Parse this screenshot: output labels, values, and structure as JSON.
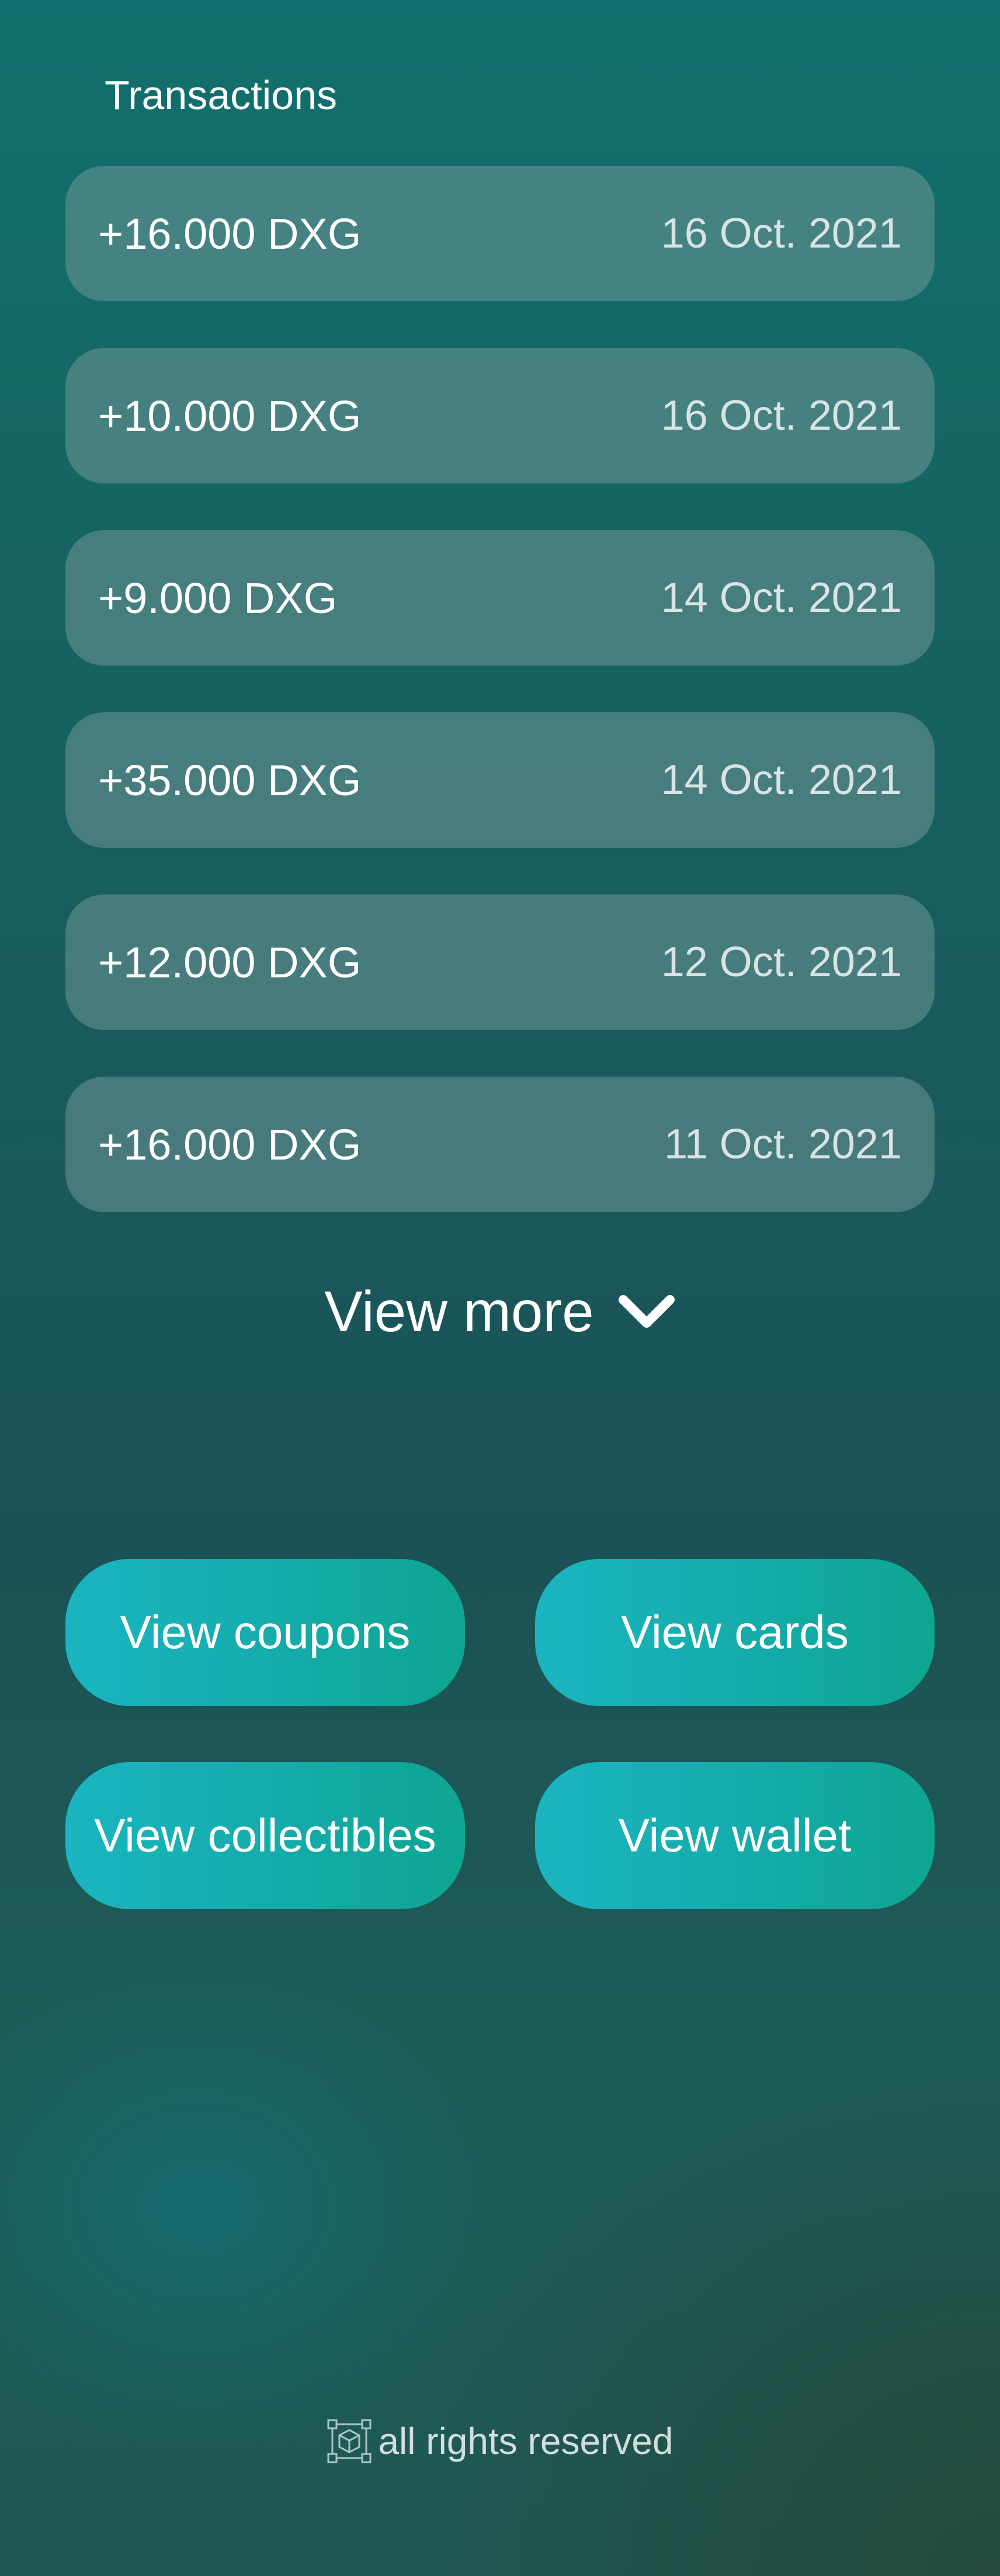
{
  "transactions": {
    "title": "Transactions",
    "items": [
      {
        "amount": "+16.000 DXG",
        "date": "16 Oct. 2021"
      },
      {
        "amount": "+10.000 DXG",
        "date": "16 Oct. 2021"
      },
      {
        "amount": "+9.000 DXG",
        "date": "14 Oct. 2021"
      },
      {
        "amount": "+35.000 DXG",
        "date": "14 Oct. 2021"
      },
      {
        "amount": "+12.000 DXG",
        "date": "12 Oct. 2021"
      },
      {
        "amount": "+16.000 DXG",
        "date": "11 Oct. 2021"
      }
    ]
  },
  "view_more": {
    "label": "View more",
    "icon": "chevron-down-icon"
  },
  "actions": {
    "coupons": "View coupons",
    "cards": "View cards",
    "collectibles": "View collectibles",
    "wallet": "View wallet"
  },
  "footer": {
    "logo_icon": "cube-network-icon",
    "text": "all rights reserved"
  },
  "colors": {
    "button_gradient_start": "#1ab5c0",
    "button_gradient_end": "#0fa592",
    "row_background": "#709696",
    "background_top": "#11706f",
    "background_bottom": "#1f5852"
  }
}
